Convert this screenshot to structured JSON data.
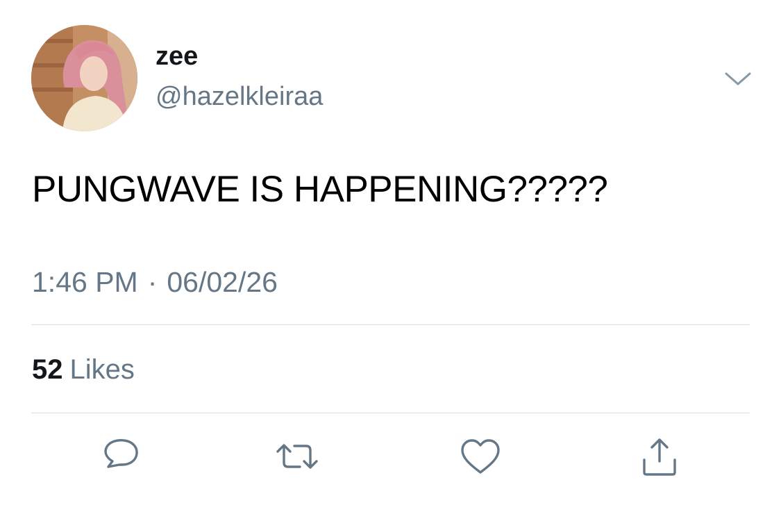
{
  "tweet": {
    "display_name": "zee",
    "handle": "@hazelkleiraa",
    "text": "PUNGWAVE IS HAPPENING?????",
    "time": "1:46 PM",
    "separator": "·",
    "date": "06/02/26",
    "likes_count": "52",
    "likes_label": "Likes"
  },
  "colors": {
    "primary_text": "#14171a",
    "secondary_text": "#657786",
    "divider": "#d9dfe3",
    "icon": "#657786"
  },
  "icons": {
    "more": "chevron-down-icon",
    "reply": "reply-icon",
    "retweet": "retweet-icon",
    "like": "heart-icon",
    "share": "share-icon"
  }
}
